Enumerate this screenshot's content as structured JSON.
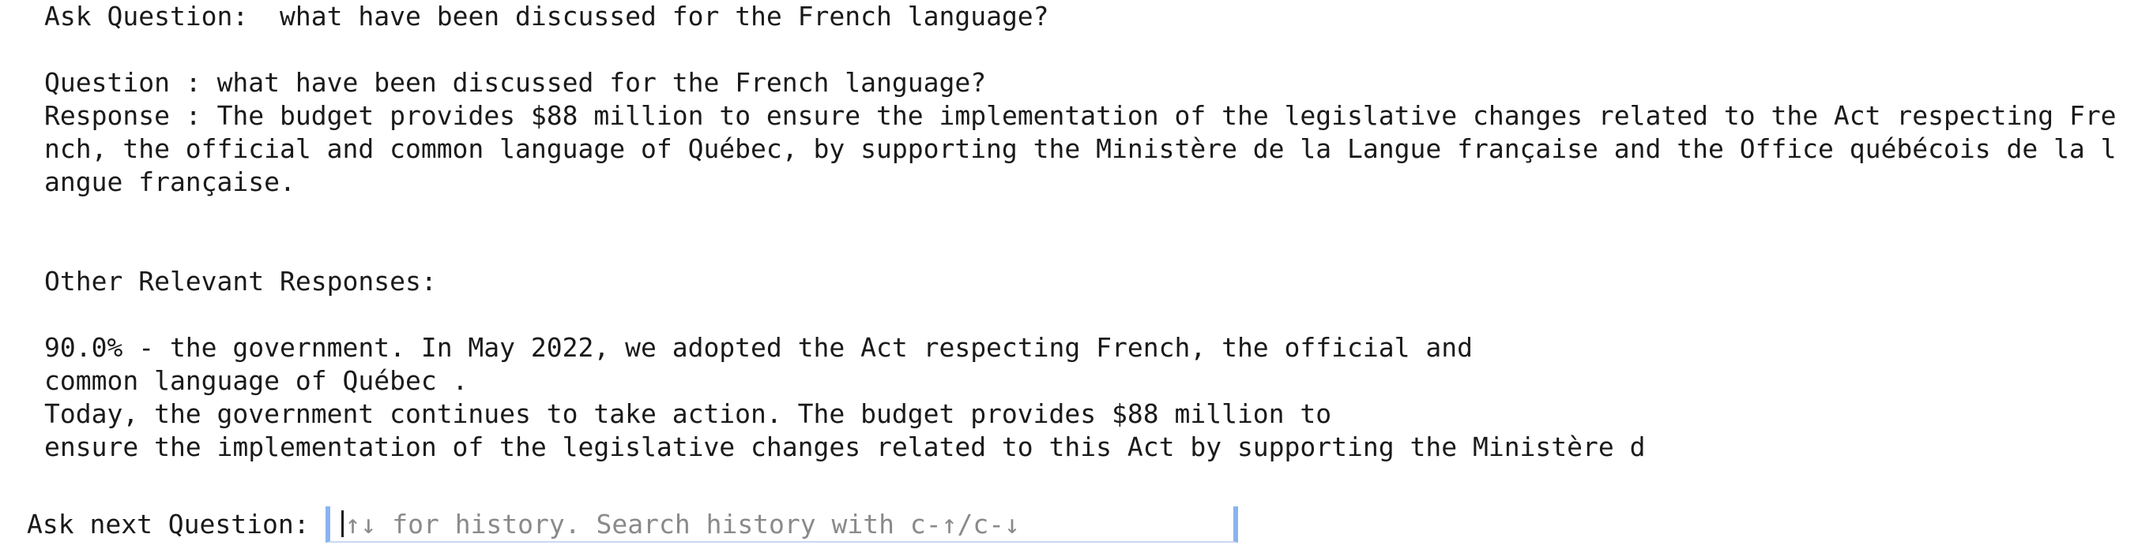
{
  "ask_question": {
    "label": "Ask Question:",
    "value": "what have been discussed for the French language?"
  },
  "answer": {
    "question_label": "Question :",
    "question_text": "what have been discussed for the French language?",
    "response_label": "Response :",
    "response_text": "The budget provides $88 million to ensure the implementation of the legislative changes related to the Act respecting French, the official and common language of Québec, by supporting the Ministère de la Langue française and the Office québécois de la langue française."
  },
  "other": {
    "heading": "Other Relevant Responses:",
    "lines": [
      "90.0% - the government. In May 2022, we adopted the Act respecting French, the official and",
      "common language of Québec .",
      "Today, the government continues to take action. The budget provides $88 million to",
      "ensure the implementation of the legislative changes related to this Act by supporting the Ministère d"
    ]
  },
  "next_question": {
    "label": "Ask next Question:",
    "placeholder": "↑↓ for history. Search history with c-↑/c-↓",
    "value": ""
  }
}
